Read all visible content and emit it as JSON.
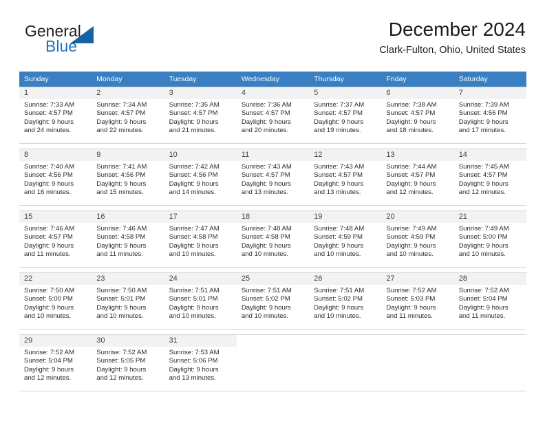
{
  "brand": {
    "logo_general": "General",
    "logo_blue": "Blue",
    "triangle_color": "#1464a5",
    "blue_text_color": "#1f72bd"
  },
  "header": {
    "month_title": "December 2024",
    "location": "Clark-Fulton, Ohio, United States"
  },
  "calendar": {
    "header_bg": "#3a7fc1",
    "daynum_bg": "#f2f2f2",
    "weekday_headers": [
      "Sunday",
      "Monday",
      "Tuesday",
      "Wednesday",
      "Thursday",
      "Friday",
      "Saturday"
    ],
    "weeks": [
      [
        {
          "day": "1",
          "sunrise": "Sunrise: 7:33 AM",
          "sunset": "Sunset: 4:57 PM",
          "daylight1": "Daylight: 9 hours",
          "daylight2": "and 24 minutes."
        },
        {
          "day": "2",
          "sunrise": "Sunrise: 7:34 AM",
          "sunset": "Sunset: 4:57 PM",
          "daylight1": "Daylight: 9 hours",
          "daylight2": "and 22 minutes."
        },
        {
          "day": "3",
          "sunrise": "Sunrise: 7:35 AM",
          "sunset": "Sunset: 4:57 PM",
          "daylight1": "Daylight: 9 hours",
          "daylight2": "and 21 minutes."
        },
        {
          "day": "4",
          "sunrise": "Sunrise: 7:36 AM",
          "sunset": "Sunset: 4:57 PM",
          "daylight1": "Daylight: 9 hours",
          "daylight2": "and 20 minutes."
        },
        {
          "day": "5",
          "sunrise": "Sunrise: 7:37 AM",
          "sunset": "Sunset: 4:57 PM",
          "daylight1": "Daylight: 9 hours",
          "daylight2": "and 19 minutes."
        },
        {
          "day": "6",
          "sunrise": "Sunrise: 7:38 AM",
          "sunset": "Sunset: 4:57 PM",
          "daylight1": "Daylight: 9 hours",
          "daylight2": "and 18 minutes."
        },
        {
          "day": "7",
          "sunrise": "Sunrise: 7:39 AM",
          "sunset": "Sunset: 4:56 PM",
          "daylight1": "Daylight: 9 hours",
          "daylight2": "and 17 minutes."
        }
      ],
      [
        {
          "day": "8",
          "sunrise": "Sunrise: 7:40 AM",
          "sunset": "Sunset: 4:56 PM",
          "daylight1": "Daylight: 9 hours",
          "daylight2": "and 16 minutes."
        },
        {
          "day": "9",
          "sunrise": "Sunrise: 7:41 AM",
          "sunset": "Sunset: 4:56 PM",
          "daylight1": "Daylight: 9 hours",
          "daylight2": "and 15 minutes."
        },
        {
          "day": "10",
          "sunrise": "Sunrise: 7:42 AM",
          "sunset": "Sunset: 4:56 PM",
          "daylight1": "Daylight: 9 hours",
          "daylight2": "and 14 minutes."
        },
        {
          "day": "11",
          "sunrise": "Sunrise: 7:43 AM",
          "sunset": "Sunset: 4:57 PM",
          "daylight1": "Daylight: 9 hours",
          "daylight2": "and 13 minutes."
        },
        {
          "day": "12",
          "sunrise": "Sunrise: 7:43 AM",
          "sunset": "Sunset: 4:57 PM",
          "daylight1": "Daylight: 9 hours",
          "daylight2": "and 13 minutes."
        },
        {
          "day": "13",
          "sunrise": "Sunrise: 7:44 AM",
          "sunset": "Sunset: 4:57 PM",
          "daylight1": "Daylight: 9 hours",
          "daylight2": "and 12 minutes."
        },
        {
          "day": "14",
          "sunrise": "Sunrise: 7:45 AM",
          "sunset": "Sunset: 4:57 PM",
          "daylight1": "Daylight: 9 hours",
          "daylight2": "and 12 minutes."
        }
      ],
      [
        {
          "day": "15",
          "sunrise": "Sunrise: 7:46 AM",
          "sunset": "Sunset: 4:57 PM",
          "daylight1": "Daylight: 9 hours",
          "daylight2": "and 11 minutes."
        },
        {
          "day": "16",
          "sunrise": "Sunrise: 7:46 AM",
          "sunset": "Sunset: 4:58 PM",
          "daylight1": "Daylight: 9 hours",
          "daylight2": "and 11 minutes."
        },
        {
          "day": "17",
          "sunrise": "Sunrise: 7:47 AM",
          "sunset": "Sunset: 4:58 PM",
          "daylight1": "Daylight: 9 hours",
          "daylight2": "and 10 minutes."
        },
        {
          "day": "18",
          "sunrise": "Sunrise: 7:48 AM",
          "sunset": "Sunset: 4:58 PM",
          "daylight1": "Daylight: 9 hours",
          "daylight2": "and 10 minutes."
        },
        {
          "day": "19",
          "sunrise": "Sunrise: 7:48 AM",
          "sunset": "Sunset: 4:59 PM",
          "daylight1": "Daylight: 9 hours",
          "daylight2": "and 10 minutes."
        },
        {
          "day": "20",
          "sunrise": "Sunrise: 7:49 AM",
          "sunset": "Sunset: 4:59 PM",
          "daylight1": "Daylight: 9 hours",
          "daylight2": "and 10 minutes."
        },
        {
          "day": "21",
          "sunrise": "Sunrise: 7:49 AM",
          "sunset": "Sunset: 5:00 PM",
          "daylight1": "Daylight: 9 hours",
          "daylight2": "and 10 minutes."
        }
      ],
      [
        {
          "day": "22",
          "sunrise": "Sunrise: 7:50 AM",
          "sunset": "Sunset: 5:00 PM",
          "daylight1": "Daylight: 9 hours",
          "daylight2": "and 10 minutes."
        },
        {
          "day": "23",
          "sunrise": "Sunrise: 7:50 AM",
          "sunset": "Sunset: 5:01 PM",
          "daylight1": "Daylight: 9 hours",
          "daylight2": "and 10 minutes."
        },
        {
          "day": "24",
          "sunrise": "Sunrise: 7:51 AM",
          "sunset": "Sunset: 5:01 PM",
          "daylight1": "Daylight: 9 hours",
          "daylight2": "and 10 minutes."
        },
        {
          "day": "25",
          "sunrise": "Sunrise: 7:51 AM",
          "sunset": "Sunset: 5:02 PM",
          "daylight1": "Daylight: 9 hours",
          "daylight2": "and 10 minutes."
        },
        {
          "day": "26",
          "sunrise": "Sunrise: 7:51 AM",
          "sunset": "Sunset: 5:02 PM",
          "daylight1": "Daylight: 9 hours",
          "daylight2": "and 10 minutes."
        },
        {
          "day": "27",
          "sunrise": "Sunrise: 7:52 AM",
          "sunset": "Sunset: 5:03 PM",
          "daylight1": "Daylight: 9 hours",
          "daylight2": "and 11 minutes."
        },
        {
          "day": "28",
          "sunrise": "Sunrise: 7:52 AM",
          "sunset": "Sunset: 5:04 PM",
          "daylight1": "Daylight: 9 hours",
          "daylight2": "and 11 minutes."
        }
      ],
      [
        {
          "day": "29",
          "sunrise": "Sunrise: 7:52 AM",
          "sunset": "Sunset: 5:04 PM",
          "daylight1": "Daylight: 9 hours",
          "daylight2": "and 12 minutes."
        },
        {
          "day": "30",
          "sunrise": "Sunrise: 7:52 AM",
          "sunset": "Sunset: 5:05 PM",
          "daylight1": "Daylight: 9 hours",
          "daylight2": "and 12 minutes."
        },
        {
          "day": "31",
          "sunrise": "Sunrise: 7:53 AM",
          "sunset": "Sunset: 5:06 PM",
          "daylight1": "Daylight: 9 hours",
          "daylight2": "and 13 minutes."
        },
        {
          "day": "",
          "sunrise": "",
          "sunset": "",
          "daylight1": "",
          "daylight2": ""
        },
        {
          "day": "",
          "sunrise": "",
          "sunset": "",
          "daylight1": "",
          "daylight2": ""
        },
        {
          "day": "",
          "sunrise": "",
          "sunset": "",
          "daylight1": "",
          "daylight2": ""
        },
        {
          "day": "",
          "sunrise": "",
          "sunset": "",
          "daylight1": "",
          "daylight2": ""
        }
      ]
    ]
  }
}
